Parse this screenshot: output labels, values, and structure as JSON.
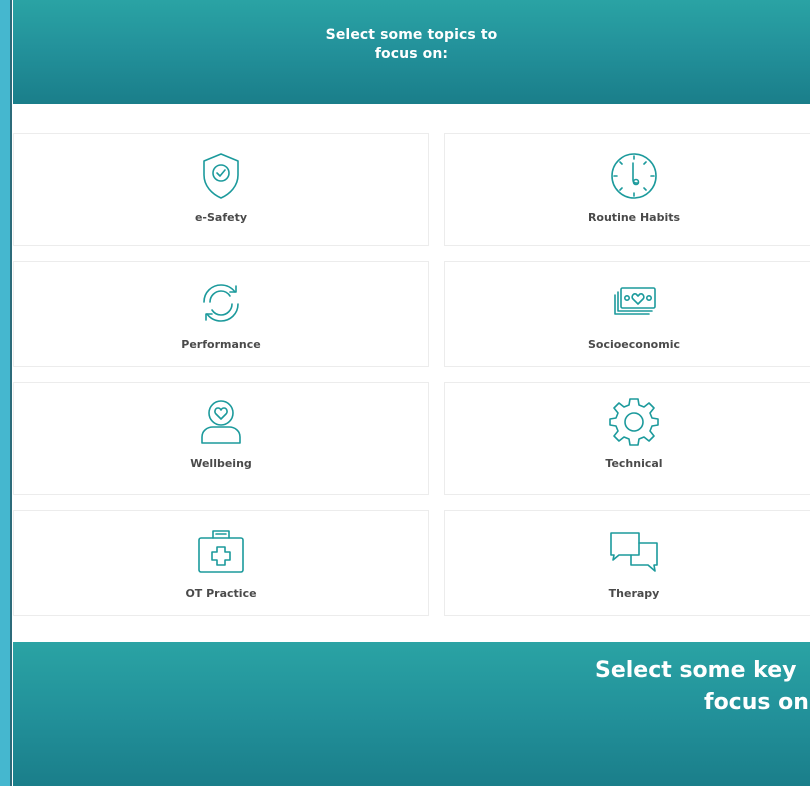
{
  "header": {
    "line1": "Select some topics to",
    "line2": "focus on:"
  },
  "topics": [
    {
      "label": "e-Safety",
      "icon": "shield-check-icon"
    },
    {
      "label": "Routine Habits",
      "icon": "clock-icon"
    },
    {
      "label": "Performance",
      "icon": "refresh-cycle-icon"
    },
    {
      "label": "Socioeconomic",
      "icon": "money-heart-icon"
    },
    {
      "label": "Wellbeing",
      "icon": "person-heart-icon"
    },
    {
      "label": "Technical",
      "icon": "gear-icon"
    },
    {
      "label": "OT Practice",
      "icon": "medical-kit-icon"
    },
    {
      "label": "Therapy",
      "icon": "chat-bubbles-icon"
    }
  ],
  "footer": {
    "line1": "Select some key",
    "line2": "focus on"
  },
  "colors": {
    "accent": "#2aa3a4",
    "accent_dark": "#1a7e8a",
    "icon": "#1c9a9c",
    "left_strip": "#45b7cf"
  }
}
